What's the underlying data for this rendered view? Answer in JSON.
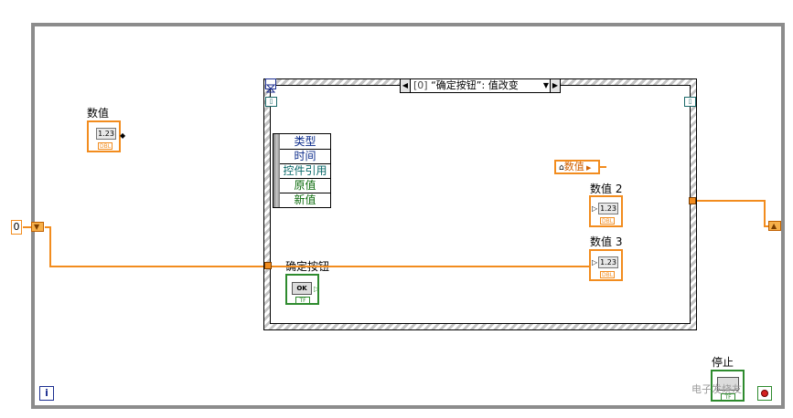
{
  "event_structure": {
    "case_index": "[0]",
    "case_label": "“确定按钮”: 值改变"
  },
  "event_data_node": {
    "fields": [
      "类型",
      "时间",
      "控件引用",
      "原值",
      "新值"
    ],
    "field_colors": [
      "#0a2a8a",
      "#0a2a8a",
      "#0a6a6a",
      "#0a6a0a",
      "#0a6a0a"
    ]
  },
  "terminals": {
    "numeric_control": {
      "label": "数值",
      "display": "1.23",
      "type_tag": "DBL"
    },
    "numeric_indicator_2": {
      "label": "数值 2",
      "display": "1.23",
      "type_tag": "DBL"
    },
    "numeric_indicator_3": {
      "label": "数值 3",
      "display": "1.23",
      "type_tag": "DBL"
    },
    "ok_button": {
      "label": "确定按钮",
      "display": "OK",
      "type_tag": "TF"
    },
    "stop_button": {
      "label": "停止",
      "type_tag": "TF"
    }
  },
  "property_node": {
    "text": "数值"
  },
  "constant": {
    "value": "0"
  },
  "iteration_terminal": {
    "text": "i"
  },
  "watermark": "电子发烧友",
  "colors": {
    "numeric_wire": "#f28c1e",
    "boolean": "#2e8b2e",
    "loop_border": "#8c8c8c"
  }
}
